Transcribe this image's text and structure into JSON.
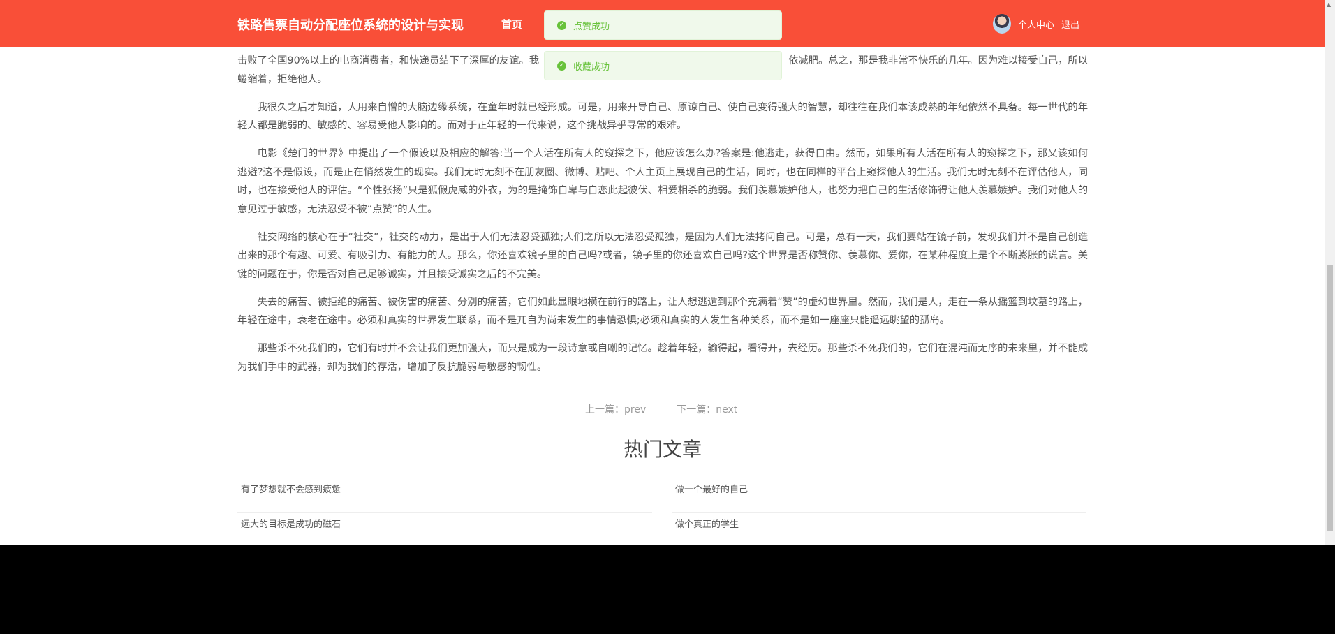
{
  "header": {
    "title": "铁路售票自动分配座位系统的设计与实现",
    "nav_home": "首页",
    "profile": "个人中心",
    "logout": "退出"
  },
  "toasts": [
    "点赞成功",
    "收藏成功"
  ],
  "article": {
    "p1_line1_left": "击败了全国90%以上的电商消费者，和快递员结下了深厚的友谊。我",
    "p1_line1_right": "依减肥。总之，那是我非常不快乐的几年。因为难以接受自己，所以",
    "p1_line2": "蜷缩着，拒绝他人。",
    "paragraphs": [
      "我很久之后才知道，人用来自憎的大脑边缘系统，在童年时就已经形成。可是，用来开导自己、原谅自己、使自己变得强大的智慧，却往往在我们本该成熟的年纪依然不具备。每一世代的年轻人都是脆弱的、敏感的、容易受他人影响的。而对于正年轻的一代来说，这个挑战异乎寻常的艰难。",
      "电影《楚门的世界》中提出了一个假设以及相应的解答:当一个人活在所有人的窥探之下，他应该怎么办?答案是:他逃走，获得自由。然而，如果所有人活在所有人的窥探之下，那又该如何逃避?这不是假设，而是正在悄然发生的现实。我们无时无刻不在朋友圈、微博、贴吧、个人主页上展现自己的生活，同时，也在同样的平台上窥探他人的生活。我们无时无刻不在评估他人，同时，也在接受他人的评估。“个性张扬”只是狐假虎威的外衣，为的是掩饰自卑与自恋此起彼伏、相爱相杀的脆弱。我们羡慕嫉妒他人，也努力把自己的生活修饰得让他人羡慕嫉妒。我们对他人的意见过于敏感，无法忍受不被“点赞”的人生。",
      "社交网络的核心在于“社交”，社交的动力，是出于人们无法忍受孤独;人们之所以无法忍受孤独，是因为人们无法拷问自己。可是，总有一天，我们要站在镜子前，发现我们并不是自己创造出来的那个有趣、可爱、有吸引力、有能力的人。那么，你还喜欢镜子里的自己吗?或者，镜子里的你还喜欢自己吗?这个世界是否称赞你、羡慕你、爱你，在某种程度上是个不断膨胀的谎言。关键的问题在于，你是否对自己足够诚实，并且接受诚实之后的不完美。",
      "失去的痛苦、被拒绝的痛苦、被伤害的痛苦、分别的痛苦，它们如此显眼地横在前行的路上，让人想逃遁到那个充满着“赞”的虚幻世界里。然而，我们是人，走在一条从摇篮到坟墓的路上，年轻在途中，衰老在途中。必须和真实的世界发生联系，而不是兀自为尚未发生的事情恐惧;必须和真实的人发生各种关系，而不是如一座座只能遥远眺望的孤岛。",
      "那些杀不死我们的，它们有时并不会让我们更加强大，而只是成为一段诗意或自嘲的记忆。趁着年轻，输得起，看得开，去经历。那些杀不死我们的，它们在混沌而无序的未来里，并不能成为我们手中的武器，却为我们的存活，增加了反抗脆弱与敏感的韧性。"
    ]
  },
  "pager": {
    "prev": "上一篇：prev",
    "next": "下一篇：next"
  },
  "hot": {
    "title": "热门文章",
    "items": [
      "有了梦想就不会感到疲惫",
      "做一个最好的自己",
      "远大的目标是成功的磁石",
      "做个真正的学生"
    ]
  }
}
